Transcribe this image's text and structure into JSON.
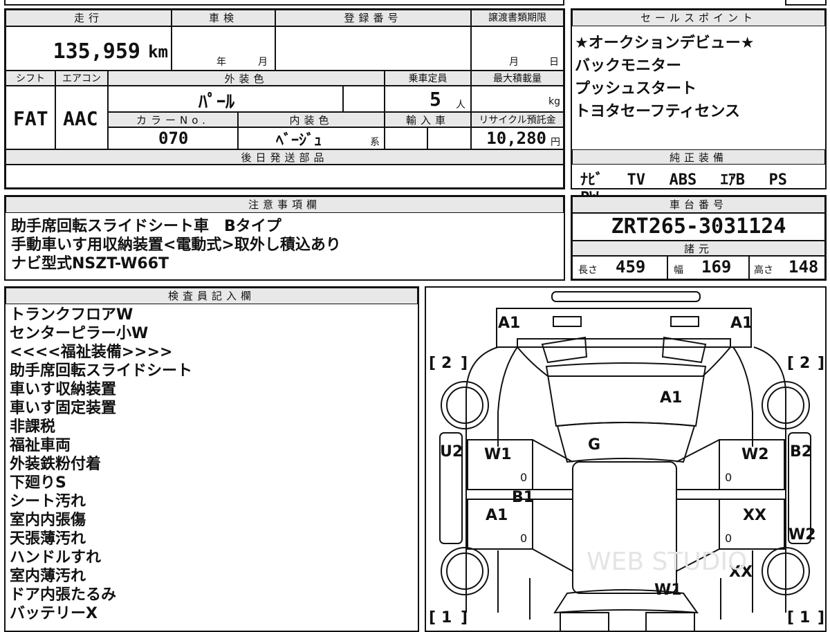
{
  "top_spec": {
    "mileage_label": "走行",
    "mileage_value": "135,959",
    "mileage_unit": "km",
    "shaken_label": "車検",
    "shaken_year": "年",
    "shaken_month": "月",
    "reg_label": "登録番号",
    "transfer_label": "譲渡書類期限",
    "transfer_month": "月",
    "transfer_day": "日",
    "shift_label": "シフト",
    "shift_value": "FAT",
    "ac_label": "エアコン",
    "ac_value": "AAC",
    "exterior_label": "外装色",
    "exterior_value": "ﾊﾟｰﾙ",
    "capacity_label": "乗車定員",
    "capacity_value": "5",
    "capacity_unit": "人",
    "load_label": "最大積載量",
    "load_unit": "kg",
    "color_no_label": "カラーNo.",
    "color_no_value": "070",
    "interior_label": "内装色",
    "interior_value": "ﾍﾞｰｼﾞｭ",
    "interior_suffix": "系",
    "import_label": "輸入車",
    "recycle_label": "リサイクル預託金",
    "recycle_value": "10,280",
    "recycle_unit": "円",
    "later_parts_label": "後日発送部品"
  },
  "sales_points": {
    "label": "セールスポイント",
    "items": [
      "★オークションデビュー★",
      "バックモニター",
      "プッシュスタート",
      "トヨタセーフティセンス"
    ]
  },
  "genuine_equipment": {
    "label": "純正装備",
    "items": [
      "ﾅﾋﾞ",
      "TV",
      "ABS",
      "ｴｱB",
      "PS",
      "PW"
    ]
  },
  "notes": {
    "label": "注意事項欄",
    "lines": [
      "助手席回転スライドシート車　Bタイプ",
      "手動車いす用収納装置<電動式>取外し積込あり",
      "ナビ型式NSZT-W66T"
    ]
  },
  "chassis": {
    "label": "車台番号",
    "value": "ZRT265-3031124"
  },
  "dimensions": {
    "label": "諸元",
    "length_label": "長さ",
    "length_value": "459",
    "width_label": "幅",
    "width_value": "169",
    "height_label": "高さ",
    "height_value": "148"
  },
  "inspector": {
    "label": "検査員記入欄",
    "lines": [
      "トランクフロアW",
      "センターピラー小W",
      "<<<<福祉装備>>>>",
      "助手席回転スライドシート",
      "車いす収納装置",
      "車いす固定装置",
      "非課税",
      "福祉車両",
      "外装鉄粉付着",
      "下廻りS",
      "シート汚れ",
      "室内内張傷",
      "天張薄汚れ",
      "ハンドルすれ",
      "室内薄汚れ",
      "ドア内張たるみ",
      "バッテリーX"
    ]
  },
  "diagram": {
    "marks": {
      "rear_left": "A1",
      "rear_right": "A1",
      "rear_glass": "A1",
      "roof": "G",
      "left_rear_door": "W1",
      "left_front_door": "A1",
      "left_pillar": "B1",
      "left_rear_fender": "U2",
      "right_rear_door": "W2",
      "right_front_door": "XX",
      "right_rear_fender": "B2",
      "right_front_fender": "W2",
      "right_front_wheel": "XX",
      "hood": "W1",
      "zero_marks": [
        "0",
        "0",
        "0",
        "0"
      ]
    },
    "tire_rear_left": "2",
    "tire_rear_right": "2",
    "tire_front_left": "1",
    "tire_front_right": "1",
    "watermark": "WEB STUDIO"
  }
}
